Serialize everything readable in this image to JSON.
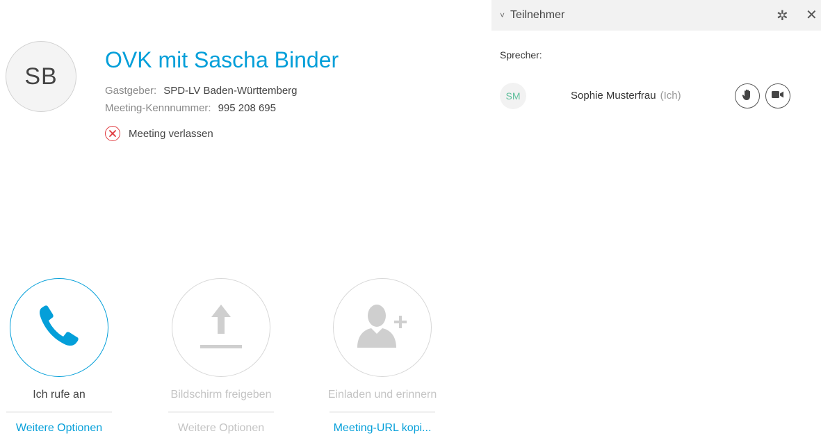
{
  "meeting": {
    "avatar_initials": "SB",
    "title": "OVK mit Sascha Binder",
    "host_label": "Gastgeber:",
    "host_value": "SPD-LV Baden-Württemberg",
    "id_label": "Meeting-Kennnummer:",
    "id_value": "995 208 695",
    "leave_label": "Meeting verlassen"
  },
  "actions": {
    "call": {
      "label": "Ich rufe an",
      "more": "Weitere Optionen",
      "icon": "phone-icon"
    },
    "share": {
      "label": "Bildschirm freigeben",
      "more": "Weitere Optionen",
      "icon": "upload-icon"
    },
    "invite": {
      "label": "Einladen und erinnern",
      "more": "Meeting-URL kopi...",
      "icon": "add-user-icon"
    }
  },
  "panel": {
    "chevron": "˅",
    "title": "Teilnehmer",
    "gear_glyph": "✲",
    "close_glyph": "✕",
    "section_label": "Sprecher:",
    "participants": [
      {
        "initials": "SM",
        "name": "Sophie Musterfrau",
        "self_tag": "(Ich)"
      }
    ]
  },
  "colors": {
    "accent": "#049fd9",
    "leave_red": "#e0393e",
    "disabled": "#c4c4c4",
    "participant_initials": "#5fbf9c"
  }
}
